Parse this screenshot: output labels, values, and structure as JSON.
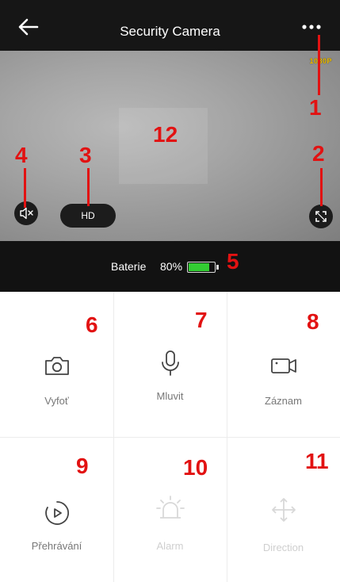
{
  "header": {
    "title": "Security Camera",
    "back_icon": "arrow-left-icon",
    "menu_icon": "more-dots-icon"
  },
  "video": {
    "resolution_badge": "1080P",
    "quality_label": "HD",
    "mute_icon": "speaker-mute-icon",
    "fullscreen_icon": "fullscreen-icon"
  },
  "status": {
    "battery_label": "Baterie",
    "battery_value": "80%",
    "battery_level": 0.8,
    "battery_color": "#33cc33"
  },
  "actions": [
    {
      "label": "Vyfoť",
      "icon": "camera-icon",
      "enabled": true
    },
    {
      "label": "Mluvit",
      "icon": "microphone-icon",
      "enabled": true
    },
    {
      "label": "Záznam",
      "icon": "video-record-icon",
      "enabled": true
    },
    {
      "label": "Přehrávání",
      "icon": "playback-icon",
      "enabled": true
    },
    {
      "label": "Alarm",
      "icon": "alarm-icon",
      "enabled": false
    },
    {
      "label": "Direction",
      "icon": "direction-icon",
      "enabled": false
    }
  ],
  "annotations": [
    "1",
    "2",
    "3",
    "4",
    "5",
    "6",
    "7",
    "8",
    "9",
    "10",
    "11",
    "12"
  ],
  "annotation_color": "#e21212"
}
